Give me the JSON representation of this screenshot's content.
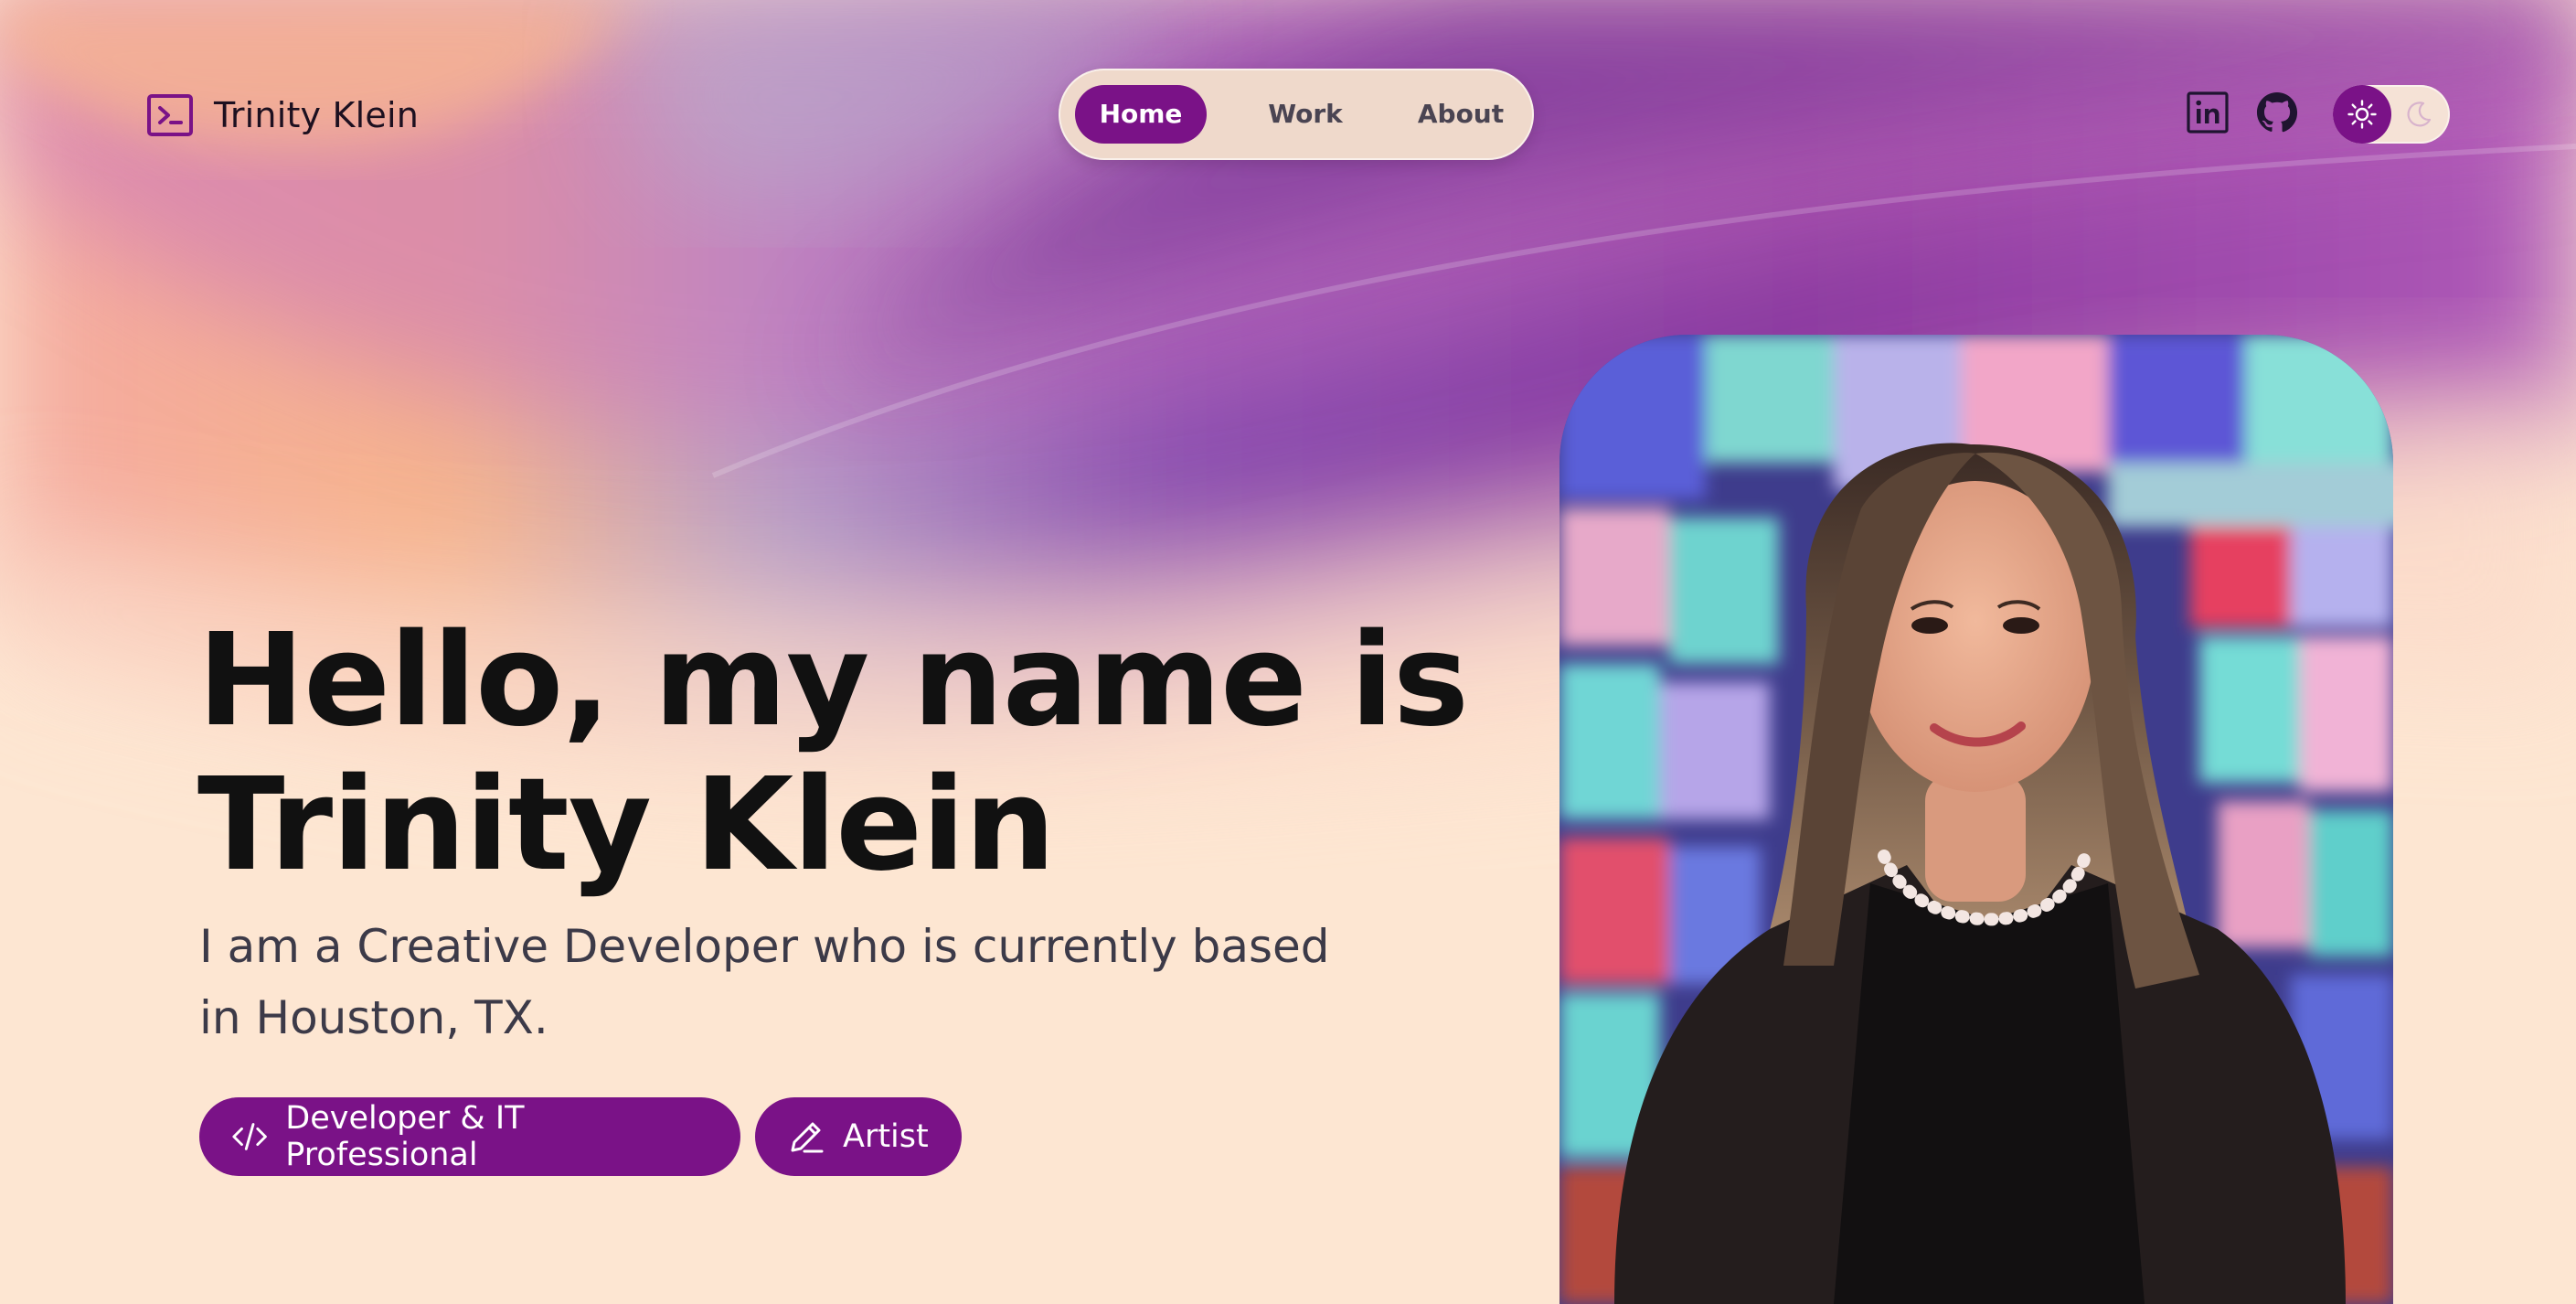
{
  "brand": {
    "name": "Trinity Klein",
    "logo_icon": "terminal-icon"
  },
  "nav": {
    "items": [
      {
        "label": "Home",
        "active": true
      },
      {
        "label": "Work",
        "active": false
      },
      {
        "label": "About",
        "active": false
      }
    ]
  },
  "social": [
    {
      "icon": "linkedin-icon"
    },
    {
      "icon": "github-icon"
    }
  ],
  "theme_toggle": {
    "selected": "light",
    "options": [
      "sun-icon",
      "moon-icon"
    ]
  },
  "hero": {
    "title_line1": "Hello, my name is",
    "title_line2": "Trinity Klein",
    "subtitle_line1": "I am a Creative Developer who is currently based",
    "subtitle_line2": "in Houston, TX."
  },
  "tags": [
    {
      "label": "Developer & IT Professional",
      "icon": "code-icon"
    },
    {
      "label": "Artist",
      "icon": "pencil-icon"
    }
  ],
  "portrait": {
    "icon": "portrait-photo"
  },
  "colors": {
    "accent": "#7a1287",
    "page_background": "#fde6d2",
    "pill_background": "#efd9cb",
    "text_dark": "#111111",
    "text_muted": "#3c3a48"
  }
}
